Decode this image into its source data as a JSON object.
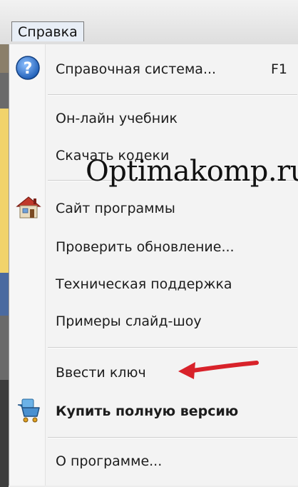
{
  "menubar": {
    "title": "Справка"
  },
  "menu": {
    "items": [
      {
        "label": "Справочная система...",
        "shortcut": "F1",
        "icon": "help-question-icon"
      },
      {
        "label": "Он-лайн учебник"
      },
      {
        "label": "Скачать кодеки"
      },
      {
        "label": "Сайт программы",
        "icon": "house-icon"
      },
      {
        "label": "Проверить обновление..."
      },
      {
        "label": "Техническая поддержка"
      },
      {
        "label": "Примеры слайд-шоу"
      },
      {
        "label": "Ввести ключ"
      },
      {
        "label": "Купить полную версию",
        "icon": "cart-icon",
        "bold": true
      },
      {
        "label": "О программе..."
      }
    ]
  },
  "watermark": {
    "text": "Optimakomp.ru"
  },
  "colors": {
    "arrow": "#d8222a",
    "help_icon": "#2f6fc4"
  }
}
